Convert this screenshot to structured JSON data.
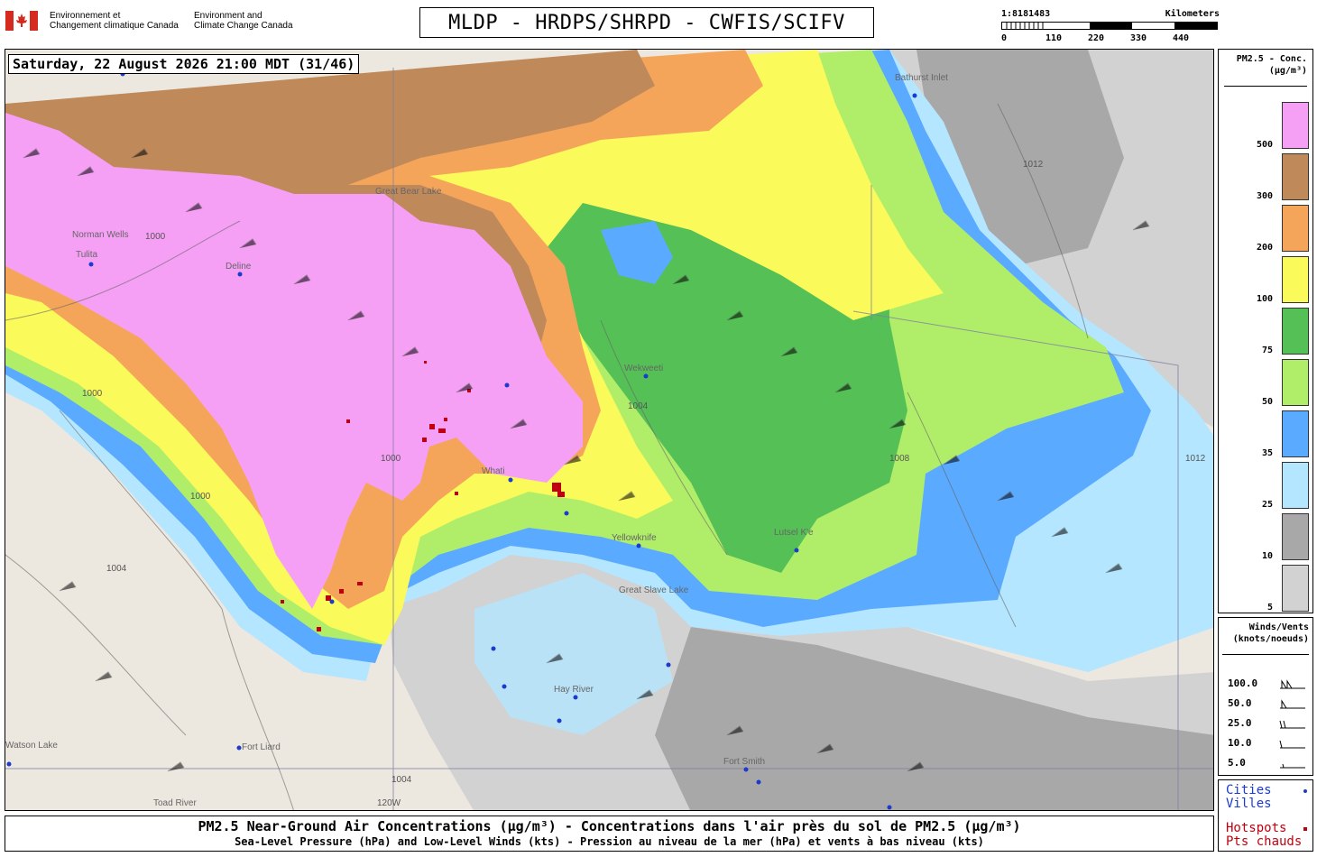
{
  "header": {
    "agency_fr_line1": "Environnement et",
    "agency_fr_line2": "Changement climatique Canada",
    "agency_en_line1": "Environment and",
    "agency_en_line2": "Climate Change Canada",
    "title": "MLDP - HRDPS/SHRPD - CWFIS/SCIFV"
  },
  "scale": {
    "ratio": "1:8181483",
    "unit": "Kilometers",
    "ticks": [
      "0",
      "110",
      "220",
      "330",
      "440"
    ]
  },
  "map": {
    "date_label": "Saturday, 22 August 2026 21:00 MDT (31/46)",
    "places": [
      "Norman Wells",
      "Tulita",
      "Deline",
      "Wekweeti",
      "Whati",
      "Yellowknife",
      "Hay River",
      "Fort Liard",
      "Fort Smith",
      "Lutsel K'e",
      "Toad River",
      "Watson Lake",
      "Bathurst Inlet",
      "Great Slave Lake",
      "Great Bear Lake"
    ],
    "isobars": [
      "1000",
      "1000",
      "1000",
      "1004",
      "1004",
      "1008",
      "1012",
      "1012",
      "1000",
      "1004"
    ],
    "graticule": [
      "120W"
    ]
  },
  "legend": {
    "title_line1": "PM2.5 - Conc.",
    "title_line2": "(μg/m³)",
    "classes": [
      {
        "label": "500",
        "color": "#f5a0f5"
      },
      {
        "label": "300",
        "color": "#c0895a"
      },
      {
        "label": "200",
        "color": "#f5a55a"
      },
      {
        "label": "100",
        "color": "#fafa5a"
      },
      {
        "label": "75",
        "color": "#55c055"
      },
      {
        "label": "50",
        "color": "#b0ee6a"
      },
      {
        "label": "35",
        "color": "#5aaaff"
      },
      {
        "label": "25",
        "color": "#b4e6ff"
      },
      {
        "label": "10",
        "color": "#a8a8a8"
      },
      {
        "label": "5",
        "color": "#d2d2d2"
      }
    ]
  },
  "winds": {
    "title_line1": "Winds/Vents",
    "title_line2": "(knots/noeuds)",
    "rows": [
      "100.0",
      "50.0",
      "25.0",
      "10.0",
      "5.0"
    ]
  },
  "key": {
    "cities_en": "Cities",
    "cities_fr": "Villes",
    "hotspots_en": "Hotspots",
    "hotspots_fr": "Pts chauds"
  },
  "footer": {
    "line1": "PM2.5 Near-Ground Air Concentrations (μg/m³) - Concentrations dans l'air près du sol de PM2.5 (μg/m³)",
    "line2": "Sea-Level Pressure (hPa) and Low-Level Winds (kts) - Pression au niveau de la mer (hPa) et vents à bas niveau (kts)"
  },
  "colors": {
    "city_dot": "#1a3ad0",
    "hotspot": "#c00010"
  }
}
